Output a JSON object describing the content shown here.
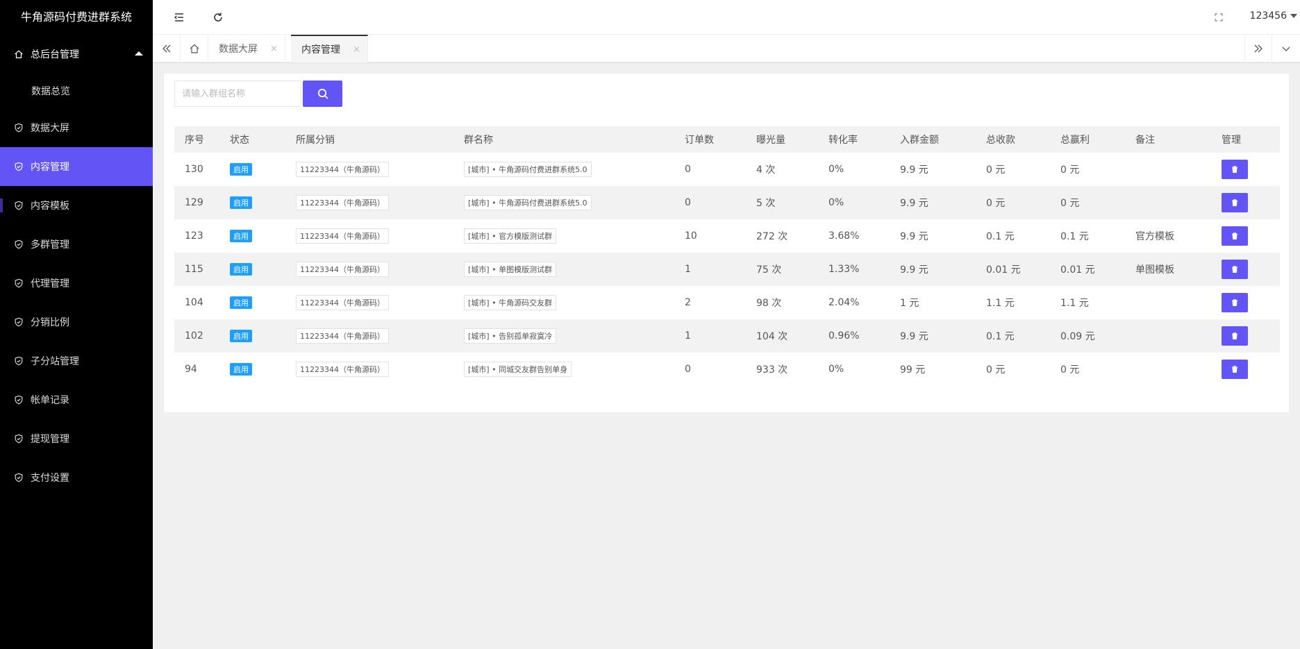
{
  "app": {
    "title": "牛角源码付费进群系统"
  },
  "sidebar": {
    "parent": {
      "label": "总后台管理",
      "icon": "home-icon"
    },
    "items": [
      {
        "label": "数据总览",
        "type": "sub"
      },
      {
        "label": "数据大屏",
        "icon": "shield-check-icon"
      },
      {
        "label": "内容管理",
        "icon": "shield-check-icon",
        "active": true
      },
      {
        "label": "内容模板",
        "icon": "shield-check-icon"
      },
      {
        "label": "多群管理",
        "icon": "shield-check-icon"
      },
      {
        "label": "代理管理",
        "icon": "shield-check-icon"
      },
      {
        "label": "分销比例",
        "icon": "shield-check-icon"
      },
      {
        "label": "子分站管理",
        "icon": "shield-check-icon"
      },
      {
        "label": "帐单记录",
        "icon": "shield-check-icon"
      },
      {
        "label": "提现管理",
        "icon": "shield-check-icon"
      },
      {
        "label": "支付设置",
        "icon": "shield-check-icon"
      }
    ]
  },
  "header": {
    "username": "123456"
  },
  "tabs": [
    {
      "label": "数据大屏",
      "close": "×"
    },
    {
      "label": "内容管理",
      "close": "×",
      "active": true
    }
  ],
  "search": {
    "placeholder": "请输入群组名称"
  },
  "table": {
    "headers": [
      "序号",
      "状态",
      "所属分销",
      "群名称",
      "订单数",
      "曝光量",
      "转化率",
      "入群金额",
      "总收款",
      "总赢利",
      "备注",
      "管理"
    ],
    "rows": [
      {
        "id": "130",
        "status": "启用",
        "dist": "11223344（牛角源码）",
        "name": "[城市] • 牛角源码付费进群系统5.0",
        "orders": "0",
        "views": "4 次",
        "rate": "0%",
        "price": "9.9 元",
        "revenue": "0 元",
        "profit": "0 元",
        "note": ""
      },
      {
        "id": "129",
        "status": "启用",
        "dist": "11223344（牛角源码）",
        "name": "[城市] • 牛角源码付费进群系统5.0",
        "orders": "0",
        "views": "5 次",
        "rate": "0%",
        "price": "9.9 元",
        "revenue": "0 元",
        "profit": "0 元",
        "note": ""
      },
      {
        "id": "123",
        "status": "启用",
        "dist": "11223344（牛角源码）",
        "name": "[城市] • 官方模版测试群",
        "orders": "10",
        "views": "272 次",
        "rate": "3.68%",
        "price": "9.9 元",
        "revenue": "0.1 元",
        "profit": "0.1 元",
        "note": "官方模板"
      },
      {
        "id": "115",
        "status": "启用",
        "dist": "11223344（牛角源码）",
        "name": "[城市] • 单图模版测试群",
        "orders": "1",
        "views": "75 次",
        "rate": "1.33%",
        "price": "9.9 元",
        "revenue": "0.01 元",
        "profit": "0.01 元",
        "note": "单图模板"
      },
      {
        "id": "104",
        "status": "启用",
        "dist": "11223344（牛角源码）",
        "name": "[城市] • 牛角源码交友群",
        "orders": "2",
        "views": "98 次",
        "rate": "2.04%",
        "price": "1 元",
        "revenue": "1.1 元",
        "profit": "1.1 元",
        "note": ""
      },
      {
        "id": "102",
        "status": "启用",
        "dist": "11223344（牛角源码）",
        "name": "[城市] • 告别孤单寂寞冷",
        "orders": "1",
        "views": "104 次",
        "rate": "0.96%",
        "price": "9.9 元",
        "revenue": "0.1 元",
        "profit": "0.09 元",
        "note": ""
      },
      {
        "id": "94",
        "status": "启用",
        "dist": "11223344（牛角源码）",
        "name": "[城市] • 同城交友群告别单身",
        "orders": "0",
        "views": "933 次",
        "rate": "0%",
        "price": "99 元",
        "revenue": "0 元",
        "profit": "0 元",
        "note": ""
      }
    ]
  },
  "colors": {
    "accent": "#6254f5",
    "badge": "#1e9fff",
    "sidebar_bg": "#000000"
  }
}
